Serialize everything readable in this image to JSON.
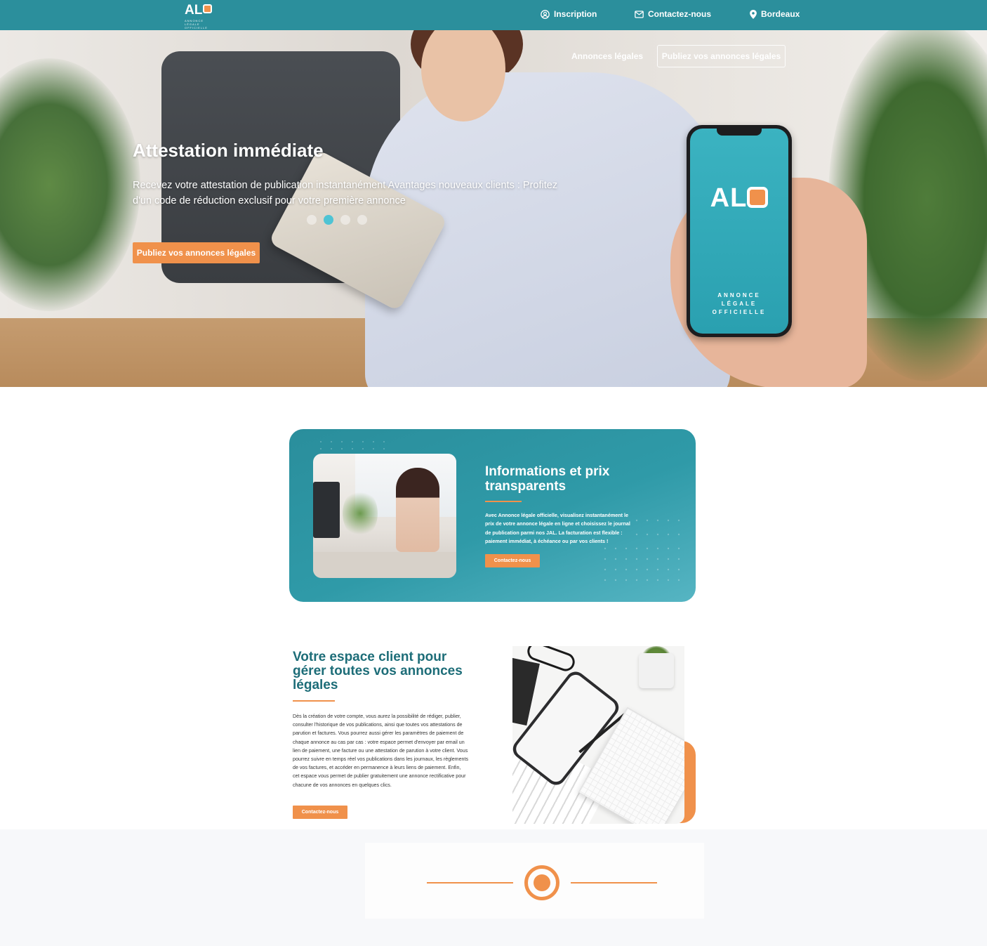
{
  "brand": {
    "logo_text": "AL",
    "logo_subtitle": "ANNONCE LÉGALE OFFICIELLE"
  },
  "topnav": {
    "inscription": "Inscription",
    "contact": "Contactez-nous",
    "location": "Bordeaux"
  },
  "hero": {
    "nav_link": "Annonces légales",
    "nav_button": "Publiez vos annonces légales",
    "title": "Attestation immédiate",
    "description": "Recevez votre attestation de publication instantanément Avantages nouveaux clients : Profitez d'un code de réduction exclusif pour votre première annonce",
    "cta": "Publiez vos annonces légales",
    "carousel_active_index": 1,
    "carousel_count": 4,
    "phone_logo": "AL",
    "phone_subtitle": "ANNONCE\nLÉGALE\nOFFICIELLE"
  },
  "info": {
    "title": "Informations et prix transparents",
    "text": "Avec Annonce légale officielle, visualisez instantanément le prix de votre annonce légale en ligne et choisissez le journal de publication parmi nos JAL. La facturation est flexible : paiement immédiat, à échéance ou par vos clients !",
    "button": "Contactez-nous"
  },
  "client": {
    "title": "Votre espace client pour gérer toutes vos annonces légales",
    "text": "Dès la création de votre compte, vous aurez la possibilité de rédiger, publier, consulter l'historique de vos publications, ainsi que toutes vos attestations de parution et factures. Vous pourrez aussi gérer les paramètres de paiement de chaque annonce au cas par cas : votre espace permet d'envoyer par email un lien de paiement, une facture ou une attestation de parution à votre client. Vous pourrez suivre en temps réel vos publications dans les journaux, les règlements de vos factures, et accéder en permanence à leurs liens de paiement. Enfin, cet espace vous permet de publier gratuitement une annonce rectificative pour chacune de vos annonces en quelques clics.",
    "button": "Contactez-nous"
  },
  "colors": {
    "teal": "#2b8f9c",
    "orange": "#f0914b",
    "title_teal": "#1d6d78"
  },
  "icons": [
    "user-circle-icon",
    "envelope-icon",
    "map-pin-icon",
    "target-icon"
  ]
}
